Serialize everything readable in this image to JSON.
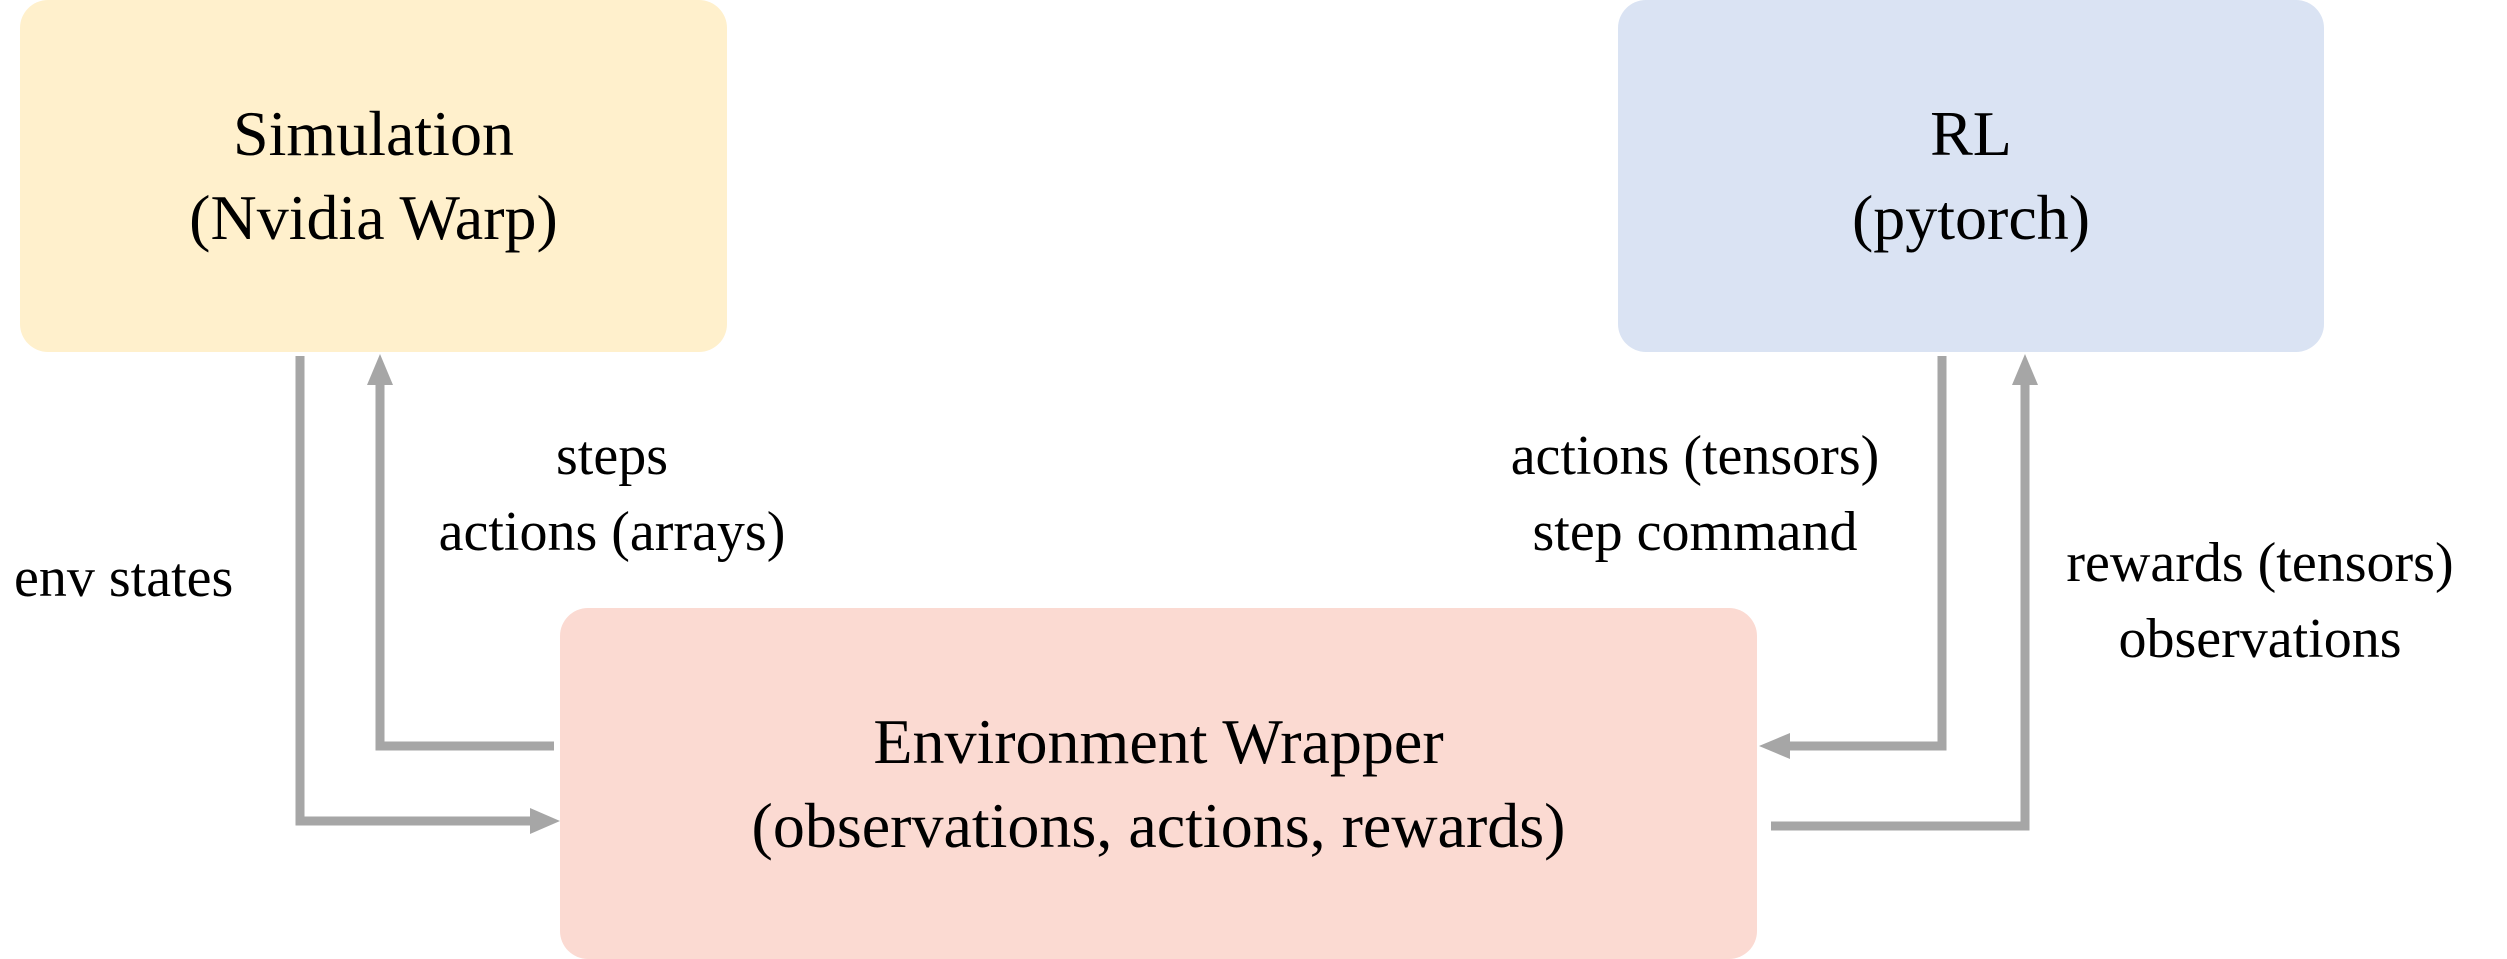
{
  "boxes": {
    "simulation": {
      "title": "Simulation",
      "subtitle": "(Nvidia Warp)",
      "color": "#fff0cc"
    },
    "rl": {
      "title": "RL",
      "subtitle": "(pytorch)",
      "color": "#dae3f3"
    },
    "env_wrapper": {
      "title": "Environment Wrapper",
      "subtitle": "(observations, actions, rewards)",
      "color": "#fbdad2"
    }
  },
  "edges": {
    "env_states": {
      "line1": "env states"
    },
    "sim_steps": {
      "line1": "steps",
      "line2": "actions (arrays)"
    },
    "rl_actions": {
      "line1": "actions (tensors)",
      "line2": "step command"
    },
    "rl_rewards": {
      "line1": "rewards (tensors)",
      "line2": "observations"
    }
  },
  "arrow_color": "#a6a6a6"
}
